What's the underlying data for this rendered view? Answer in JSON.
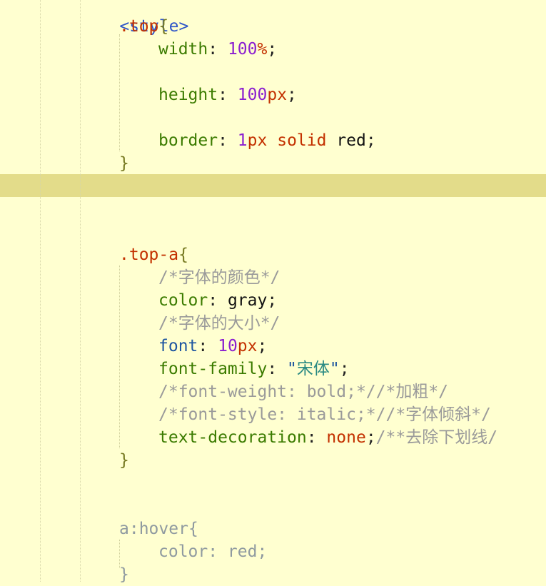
{
  "colors": {
    "background": "#ffffd0",
    "current_line": "#e3dc8a",
    "property": "#3b7b00",
    "selector": "#c33100",
    "number": "#8b1fd0",
    "comment": "#9a9a9a"
  },
  "code": {
    "style_open": "<style>",
    "top": {
      "selector": ".top",
      "open_brace": "{",
      "close_brace": "}",
      "width_prop": "width",
      "width_num": "100",
      "width_unit": "%",
      "height_prop": "height",
      "height_num": "100",
      "height_unit": "px",
      "border_prop": "border",
      "border_num": "1",
      "border_unit": "px",
      "border_style": "solid",
      "border_color": "red"
    },
    "top_a": {
      "selector": ".top-a",
      "open_brace": "{",
      "close_brace": "}",
      "comment_color": "/*字体的颜色*/",
      "color_prop": "color",
      "color_val": "gray",
      "comment_size": "/*字体的大小*/",
      "font_prop": "font",
      "font_num": "10",
      "font_unit": "px",
      "family_prop": "font-family",
      "family_val": "宋体",
      "comment_weight": "/*font-weight: bold;*//*加粗*/",
      "comment_style": "/*font-style: italic;*//*字体倾斜*/",
      "deco_prop": "text-decoration",
      "deco_val": "none",
      "deco_comment": "/**去除下划线/"
    },
    "hover": {
      "selector": "a:hover",
      "open_brace": "{",
      "close_brace": "}",
      "color_line": "color: red;"
    }
  }
}
